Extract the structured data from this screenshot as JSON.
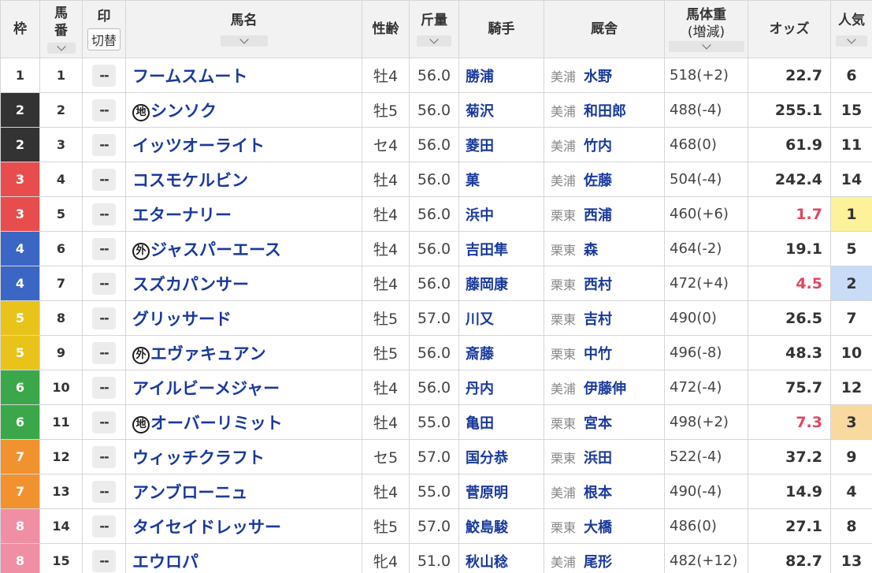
{
  "header": {
    "waku": "枠",
    "umaban_top": "馬",
    "umaban_bottom": "番",
    "mark": "印",
    "mark_toggle": "切替",
    "name": "馬名",
    "sex_age": "性齢",
    "kinryo": "斤量",
    "jockey": "騎手",
    "stable": "厩舎",
    "weight": "馬体重",
    "weight_sub": "(増減)",
    "odds": "オッズ",
    "popularity": "人気"
  },
  "waku_colors": {
    "1": {
      "bg": "#ffffff",
      "fg": "#333333"
    },
    "2": {
      "bg": "#333333",
      "fg": "#ffffff"
    },
    "3": {
      "bg": "#e84d4d",
      "fg": "#ffffff"
    },
    "4": {
      "bg": "#3b66c4",
      "fg": "#ffffff"
    },
    "5": {
      "bg": "#e8c41a",
      "fg": "#ffffff"
    },
    "6": {
      "bg": "#3aa84a",
      "fg": "#ffffff"
    },
    "7": {
      "bg": "#f0922e",
      "fg": "#ffffff"
    },
    "8": {
      "bg": "#f08ea3",
      "fg": "#ffffff"
    }
  },
  "popularity_highlights": {
    "1": "#fdf19a",
    "2": "#c9dcf7",
    "3": "#f8d9a0"
  },
  "rows": [
    {
      "waku": "1",
      "umaban": "1",
      "mark": "--",
      "badge": "",
      "name": "フームスムート",
      "sex_age": "牡4",
      "kinryo": "56.0",
      "jockey": "勝浦",
      "area": "美浦",
      "trainer": "水野",
      "weight": "518(+2)",
      "odds": "22.7",
      "odds_hot": false,
      "pop": "6"
    },
    {
      "waku": "2",
      "umaban": "2",
      "mark": "--",
      "badge": "地",
      "name": "シンソク",
      "sex_age": "牡5",
      "kinryo": "56.0",
      "jockey": "菊沢",
      "area": "美浦",
      "trainer": "和田郎",
      "weight": "488(-4)",
      "odds": "255.1",
      "odds_hot": false,
      "pop": "15"
    },
    {
      "waku": "2",
      "umaban": "3",
      "mark": "--",
      "badge": "",
      "name": "イッツオーライト",
      "sex_age": "セ4",
      "kinryo": "56.0",
      "jockey": "菱田",
      "area": "美浦",
      "trainer": "竹内",
      "weight": "468(0)",
      "odds": "61.9",
      "odds_hot": false,
      "pop": "11"
    },
    {
      "waku": "3",
      "umaban": "4",
      "mark": "--",
      "badge": "",
      "name": "コスモケルビン",
      "sex_age": "牡4",
      "kinryo": "56.0",
      "jockey": "菓",
      "area": "美浦",
      "trainer": "佐藤",
      "weight": "504(-4)",
      "odds": "242.4",
      "odds_hot": false,
      "pop": "14"
    },
    {
      "waku": "3",
      "umaban": "5",
      "mark": "--",
      "badge": "",
      "name": "エターナリー",
      "sex_age": "牡4",
      "kinryo": "56.0",
      "jockey": "浜中",
      "area": "栗東",
      "trainer": "西浦",
      "weight": "460(+6)",
      "odds": "1.7",
      "odds_hot": true,
      "pop": "1"
    },
    {
      "waku": "4",
      "umaban": "6",
      "mark": "--",
      "badge": "外",
      "name": "ジャスパーエース",
      "sex_age": "牡4",
      "kinryo": "56.0",
      "jockey": "吉田隼",
      "area": "栗東",
      "trainer": "森",
      "weight": "464(-2)",
      "odds": "19.1",
      "odds_hot": false,
      "pop": "5"
    },
    {
      "waku": "4",
      "umaban": "7",
      "mark": "--",
      "badge": "",
      "name": "スズカパンサー",
      "sex_age": "牡4",
      "kinryo": "56.0",
      "jockey": "藤岡康",
      "area": "栗東",
      "trainer": "西村",
      "weight": "472(+4)",
      "odds": "4.5",
      "odds_hot": true,
      "pop": "2"
    },
    {
      "waku": "5",
      "umaban": "8",
      "mark": "--",
      "badge": "",
      "name": "グリッサード",
      "sex_age": "牡5",
      "kinryo": "57.0",
      "jockey": "川又",
      "area": "栗東",
      "trainer": "吉村",
      "weight": "490(0)",
      "odds": "26.5",
      "odds_hot": false,
      "pop": "7"
    },
    {
      "waku": "5",
      "umaban": "9",
      "mark": "--",
      "badge": "外",
      "name": "エヴァキュアン",
      "sex_age": "牡5",
      "kinryo": "56.0",
      "jockey": "斎藤",
      "area": "栗東",
      "trainer": "中竹",
      "weight": "496(-8)",
      "odds": "48.3",
      "odds_hot": false,
      "pop": "10"
    },
    {
      "waku": "6",
      "umaban": "10",
      "mark": "--",
      "badge": "",
      "name": "アイルビーメジャー",
      "sex_age": "牡4",
      "kinryo": "56.0",
      "jockey": "丹内",
      "area": "美浦",
      "trainer": "伊藤伸",
      "weight": "472(-4)",
      "odds": "75.7",
      "odds_hot": false,
      "pop": "12"
    },
    {
      "waku": "6",
      "umaban": "11",
      "mark": "--",
      "badge": "地",
      "name": "オーバーリミット",
      "sex_age": "牡4",
      "kinryo": "55.0",
      "jockey": "亀田",
      "area": "栗東",
      "trainer": "宮本",
      "weight": "498(+2)",
      "odds": "7.3",
      "odds_hot": true,
      "pop": "3"
    },
    {
      "waku": "7",
      "umaban": "12",
      "mark": "--",
      "badge": "",
      "name": "ウィッチクラフト",
      "sex_age": "セ5",
      "kinryo": "57.0",
      "jockey": "国分恭",
      "area": "栗東",
      "trainer": "浜田",
      "weight": "522(-4)",
      "odds": "37.2",
      "odds_hot": false,
      "pop": "9"
    },
    {
      "waku": "7",
      "umaban": "13",
      "mark": "--",
      "badge": "",
      "name": "アンブローニュ",
      "sex_age": "牡4",
      "kinryo": "55.0",
      "jockey": "菅原明",
      "area": "美浦",
      "trainer": "根本",
      "weight": "490(-4)",
      "odds": "14.9",
      "odds_hot": false,
      "pop": "4"
    },
    {
      "waku": "8",
      "umaban": "14",
      "mark": "--",
      "badge": "",
      "name": "タイセイドレッサー",
      "sex_age": "牡5",
      "kinryo": "57.0",
      "jockey": "鮫島駿",
      "area": "栗東",
      "trainer": "大橋",
      "weight": "486(0)",
      "odds": "27.1",
      "odds_hot": false,
      "pop": "8"
    },
    {
      "waku": "8",
      "umaban": "15",
      "mark": "--",
      "badge": "",
      "name": "エウロパ",
      "sex_age": "牝4",
      "kinryo": "51.0",
      "jockey": "秋山稔",
      "area": "美浦",
      "trainer": "尾形",
      "weight": "482(+12)",
      "odds": "82.7",
      "odds_hot": false,
      "pop": "13"
    }
  ]
}
